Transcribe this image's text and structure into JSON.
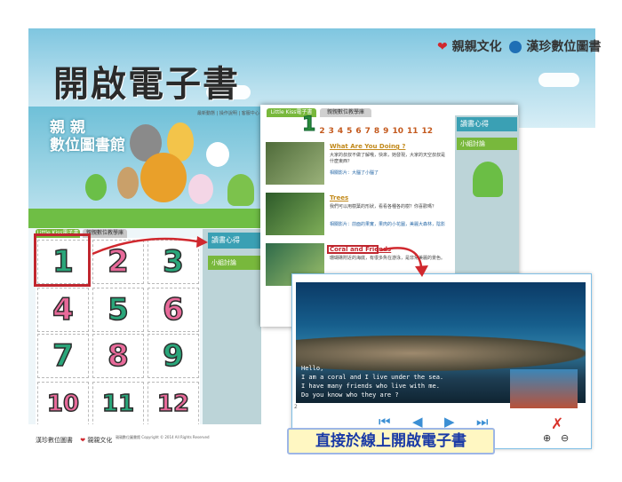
{
  "banner": {
    "title": "開啟電子書",
    "logo_left": "親親文化",
    "logo_right": "漢珍數位圖書"
  },
  "site": {
    "logo_lines": [
      "親 親",
      "數位圖書館"
    ],
    "nav_text": "最新動態 | 操作說明 | 客服中心",
    "tabs": [
      "Little Kiss電子書",
      "親親數位教學庫"
    ],
    "numbers": [
      "1",
      "2",
      "3",
      "4",
      "5",
      "6",
      "7",
      "8",
      "9",
      "10",
      "11",
      "12"
    ],
    "panel_top": "讀書心得",
    "panel_sub": "小組討論",
    "footer_left": "漢珍數位圖書",
    "footer_right": "親親文化",
    "footer_copy": "親親數位圖書館 Copyright © 2014 All Rights Reserved"
  },
  "middle": {
    "tabs": [
      "Little Kiss電子書",
      "親親數位教學庫"
    ],
    "pager_current": "1",
    "pager_numbers": [
      "2",
      "3",
      "4",
      "5",
      "6",
      "7",
      "8",
      "9",
      "10",
      "11",
      "12"
    ],
    "panel_top": "讀書心得",
    "panel_sub": "小組討論",
    "stories": [
      {
        "title": "What Are You Doing ?",
        "desc": "大家的叔叔不做了解哦，快來，她發現，大家的天空叔叔是什麼東西？",
        "tags": "相關影片：大腦了小腦了"
      },
      {
        "title": "Trees",
        "desc": "我們可以用樹葉的形狀，看看各種各的樹？你喜歡嗎？",
        "tags": "相關影片：前面的果實，果肉的小花圖，美麗大森林，陰影"
      },
      {
        "title": "Coral and Friends",
        "desc": "珊瑚礁附近的海底，有很多魚在游泳，是非常美麗的景色。",
        "tags": ""
      }
    ]
  },
  "ebook": {
    "text_lines": [
      "Hello,",
      "I am a coral and I live under the sea.",
      "I have many friends who live with me.",
      "Do you know who they are ?"
    ],
    "page_number": "2",
    "controls": {
      "first": "⏮",
      "prev": "◀",
      "next": "▶",
      "last": "⏭",
      "close": "✗",
      "zoom_in": "⊕",
      "zoom_out": "⊖"
    }
  },
  "caption": "直接於線上開啟電子書",
  "colors": {
    "highlight": "#c0262e",
    "accent_green": "#78b83c",
    "accent_blue": "#3aa0b4"
  }
}
